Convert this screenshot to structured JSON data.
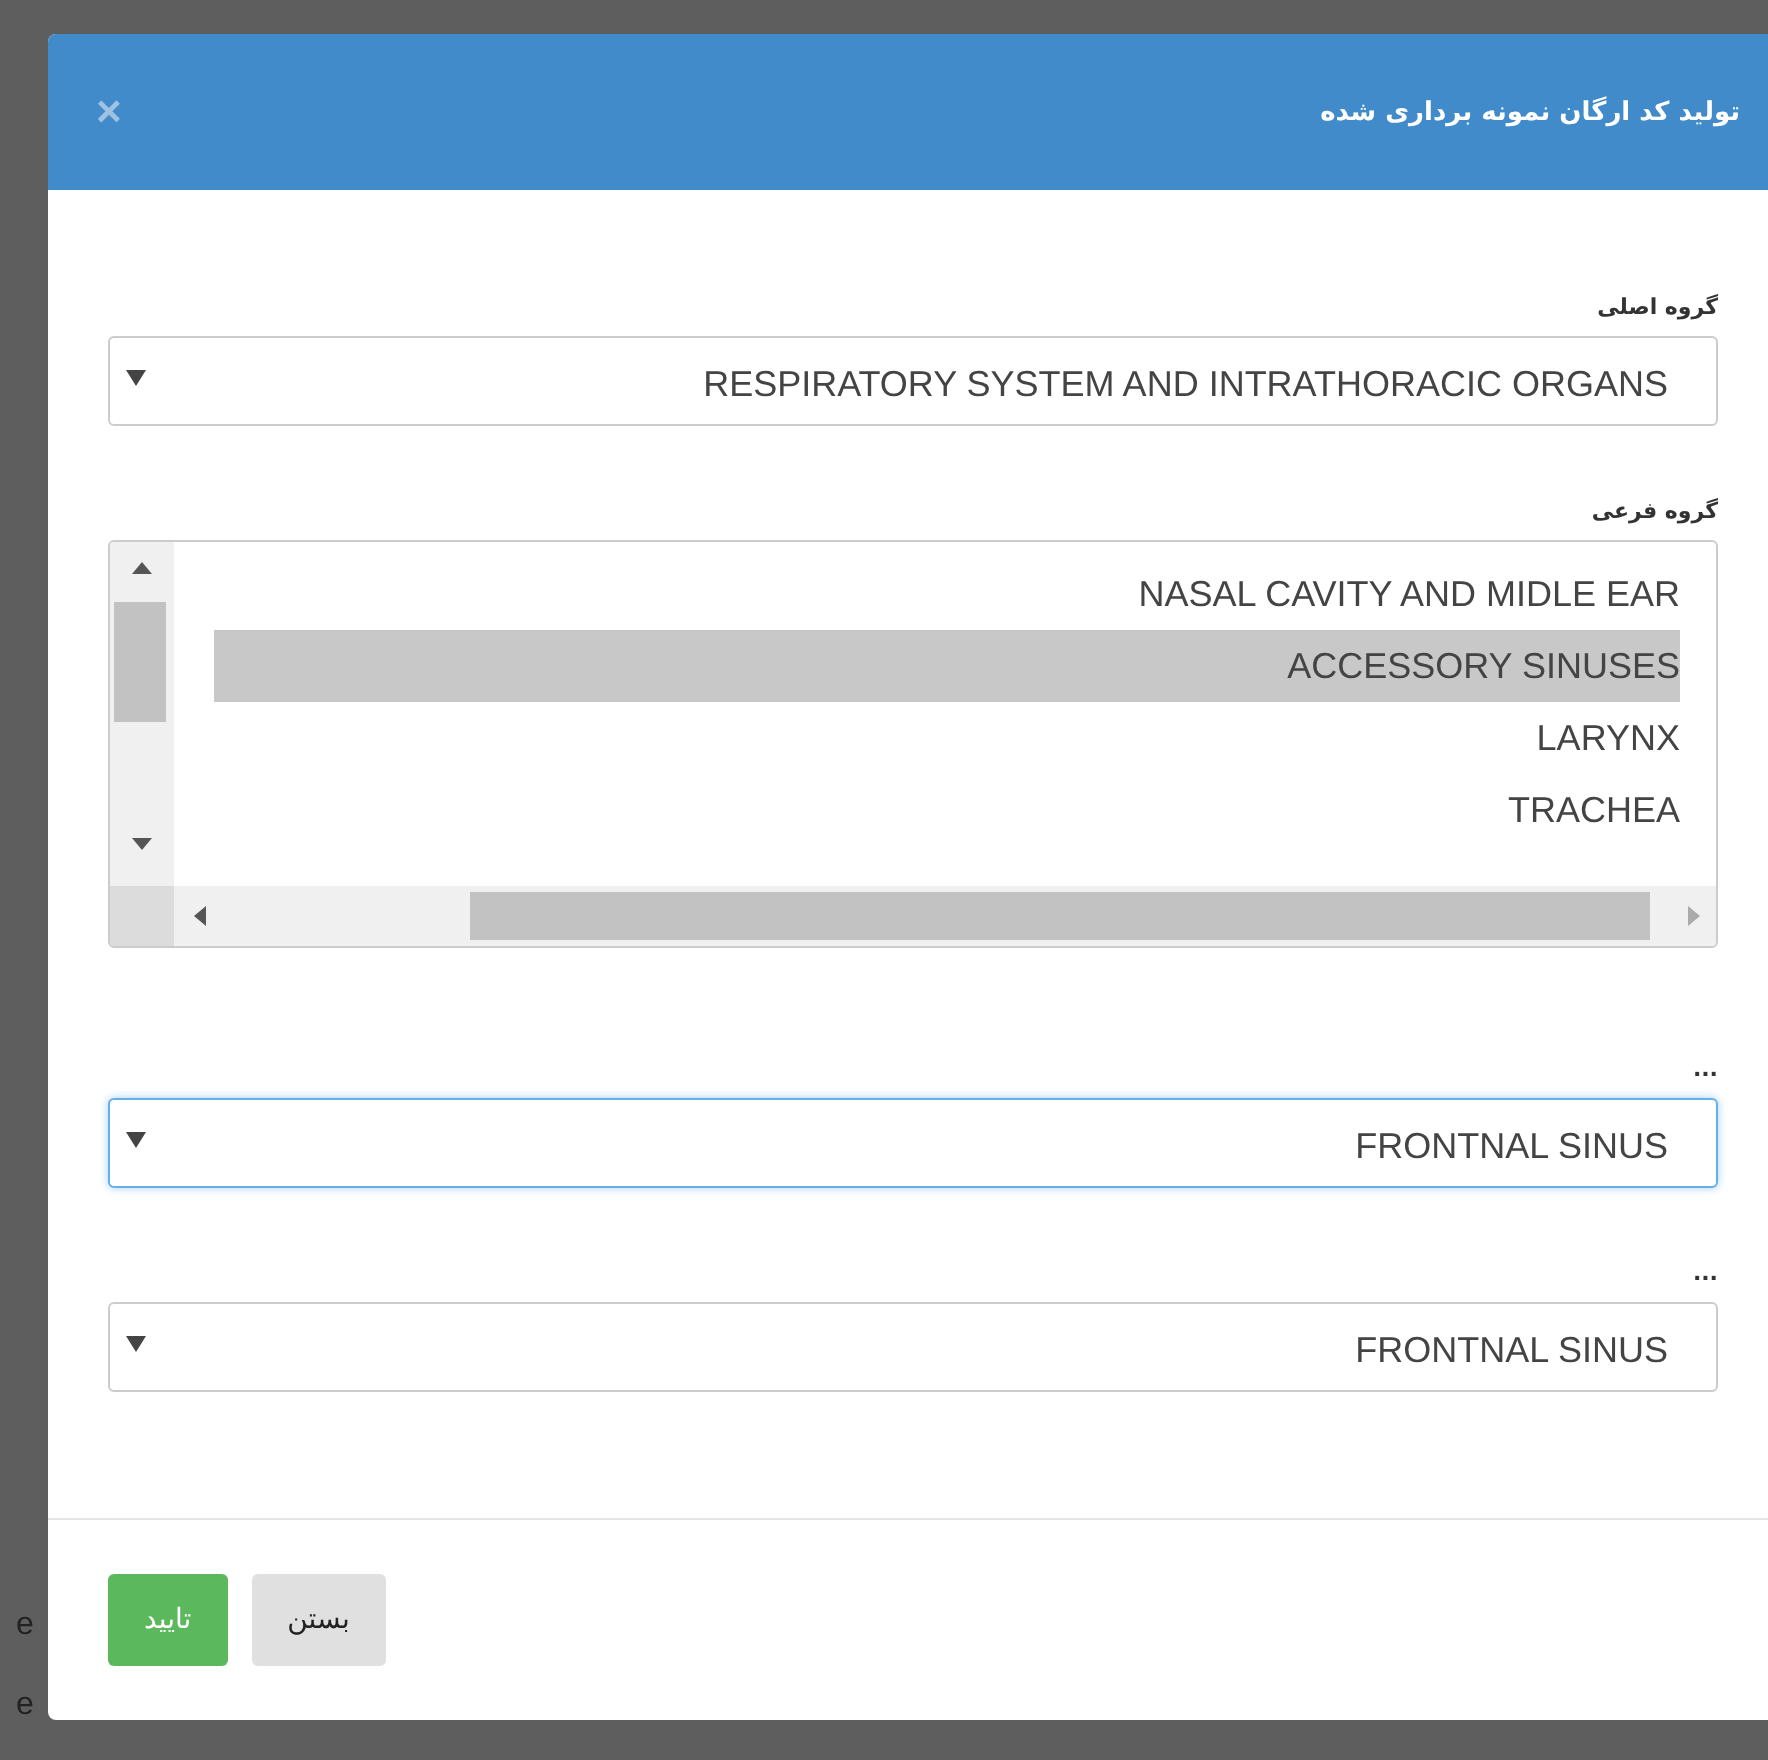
{
  "background": {
    "side_texts": [
      "e",
      "e"
    ]
  },
  "dialog": {
    "title": "تولید کد ارگان نمونه برداری شده",
    "close_glyph": "×"
  },
  "fields": [
    {
      "kind": "select",
      "label": "گروه اصلی",
      "value": "RESPIRATORY SYSTEM AND INTRATHORACIC ORGANS",
      "focused": false
    },
    {
      "kind": "listbox",
      "label": "گروه فرعی",
      "items": [
        {
          "text": "NASAL CAVITY AND MIDLE EAR",
          "selected": false
        },
        {
          "text": "ACCESSORY SINUSES",
          "selected": true
        },
        {
          "text": "LARYNX",
          "selected": false
        },
        {
          "text": "TRACHEA",
          "selected": false
        }
      ]
    },
    {
      "kind": "select",
      "label": "...",
      "value": "FRONTNAL SINUS",
      "focused": true
    },
    {
      "kind": "select",
      "label": "...",
      "value": "FRONTNAL SINUS",
      "focused": false
    }
  ],
  "buttons": [
    {
      "label": "بستن",
      "kind": "default"
    },
    {
      "label": "تایید",
      "kind": "primary"
    }
  ]
}
